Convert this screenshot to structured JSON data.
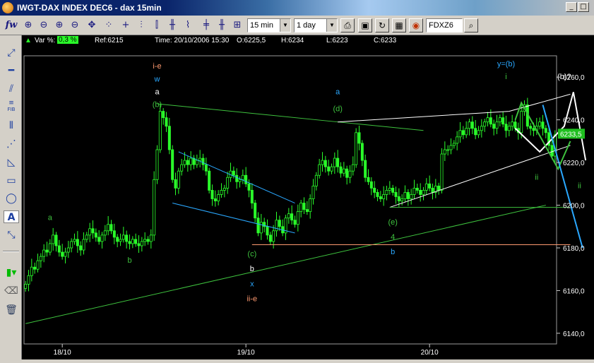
{
  "window": {
    "title": "IWGT-DAX INDEX DEC6 - dax 15min"
  },
  "toolbar": {
    "period": "15 min",
    "range": "1 day",
    "symbol": "FDXZ6",
    "logo_text": "fw"
  },
  "info": {
    "var_label": "Var %:",
    "var_value": "0,3 %",
    "ref": "Ref:6215",
    "time": "Time: 20/10/2006 15:30",
    "open": "O:6225,5",
    "high": "H:6234",
    "low": "L:6223",
    "close": "C:6233"
  },
  "left_toolbar": {
    "fib_label": "FIB",
    "text_tool_label": "A"
  },
  "colors": {
    "candles": "#2aff2a",
    "wave_green": "#3ec23e",
    "wave_blue": "#2aa8ff",
    "wave_white": "#ffffff",
    "wave_orange": "#ff9a70",
    "price_box": "#1fbf1f"
  },
  "chart_data": {
    "type": "candlestick",
    "title": "",
    "ylim": [
      6135,
      6270
    ],
    "yticks": [
      "6260,0",
      "6240,0",
      "6220,0",
      "6200,0",
      "6180,0",
      "6160,0",
      "6140,0"
    ],
    "xticks": [
      "18/10",
      "19/10",
      "20/10"
    ],
    "last_price_label": "6233,5",
    "closes": [
      6163,
      6167,
      6171,
      6170,
      6174,
      6176,
      6179,
      6178,
      6182,
      6186,
      6181,
      6178,
      6176,
      6178,
      6180,
      6183,
      6184,
      6181,
      6179,
      6184,
      6186,
      6189,
      6187,
      6185,
      6183,
      6186,
      6188,
      6191,
      6188,
      6185,
      6183,
      6184,
      6186,
      6183,
      6182,
      6184,
      6182,
      6181,
      6183,
      6184,
      6183,
      6186,
      6212,
      6226,
      6244,
      6241,
      6237,
      6226,
      6212,
      6208,
      6216,
      6219,
      6221,
      6219,
      6222,
      6219,
      6221,
      6222,
      6219,
      6216,
      6207,
      6203,
      6202,
      6205,
      6207,
      6208,
      6213,
      6216,
      6214,
      6211,
      6212,
      6214,
      6210,
      6207,
      6201,
      6194,
      6187,
      6192,
      6190,
      6186,
      6183,
      6188,
      6193,
      6190,
      6187,
      6194,
      6196,
      6193,
      6191,
      6197,
      6201,
      6198,
      6197,
      6203,
      6209,
      6214,
      6219,
      6221,
      6218,
      6216,
      6218,
      6222,
      6218,
      6215,
      6217,
      6213,
      6216,
      6219,
      6234,
      6229,
      6221,
      6213,
      6211,
      6208,
      6206,
      6204,
      6203,
      6205,
      6207,
      6208,
      6206,
      6204,
      6202,
      6203,
      6206,
      6203,
      6205,
      6208,
      6207,
      6205,
      6207,
      6210,
      6208,
      6206,
      6209,
      6207,
      6224,
      6226,
      6226,
      6228,
      6229,
      6232,
      6235,
      6233,
      6236,
      6239,
      6236,
      6233,
      6235,
      6237,
      6239,
      6241,
      6238,
      6236,
      6239,
      6241,
      6238,
      6235,
      6237,
      6239,
      6236,
      6234,
      6244,
      6247,
      6237,
      6236,
      6235,
      6237,
      6239,
      6236,
      6234,
      6228,
      6223,
      6233
    ],
    "trend_lines": [
      {
        "points": [
          [
            0,
            6144.5
          ],
          [
            170,
            6200
          ]
        ],
        "color": "wave_green"
      },
      {
        "points": [
          [
            43,
            6247.5
          ],
          [
            102,
            6239
          ],
          [
            130,
            6235
          ]
        ],
        "color": "wave_green"
      },
      {
        "points": [
          [
            102,
            6239
          ],
          [
            158,
            6244
          ],
          [
            178,
            6252
          ]
        ],
        "color": "wave_white"
      },
      {
        "points": [
          [
            119,
            6199
          ],
          [
            178,
            6228
          ]
        ],
        "color": "wave_white"
      },
      {
        "points": [
          [
            50,
            6225
          ],
          [
            88,
            6201
          ]
        ],
        "color": "wave_blue"
      },
      {
        "points": [
          [
            48,
            6201
          ],
          [
            88,
            6187
          ]
        ],
        "color": "wave_blue"
      },
      {
        "points": [
          [
            119,
            6199
          ],
          [
            178,
            6199
          ]
        ],
        "color": "wave_green"
      },
      {
        "points": [
          [
            74,
            6181.5
          ],
          [
            178,
            6181.5
          ]
        ],
        "color": "wave_orange"
      }
    ],
    "projections": [
      {
        "points": [
          [
            160,
            6236
          ],
          [
            168,
            6225
          ],
          [
            176,
            6237
          ],
          [
            179,
            6253
          ],
          [
            183,
            6221
          ]
        ],
        "color": "wave_white"
      },
      {
        "points": [
          [
            160,
            6240
          ],
          [
            162,
            6248
          ],
          [
            169,
            6230
          ],
          [
            174,
            6217
          ],
          [
            178,
            6230
          ]
        ],
        "color": "wave_green"
      },
      {
        "points": [
          [
            169,
            6247
          ],
          [
            182,
            6180
          ]
        ],
        "color": "wave_blue"
      }
    ],
    "annotations": [
      {
        "text": "i-e",
        "x": 43,
        "y": 6264,
        "color": "wave_orange"
      },
      {
        "text": "w",
        "x": 43,
        "y": 6258,
        "color": "wave_blue"
      },
      {
        "text": "a",
        "x": 43,
        "y": 6252,
        "color": "wave_white"
      },
      {
        "text": "(b)",
        "x": 43,
        "y": 6246,
        "color": "wave_green"
      },
      {
        "text": "a",
        "x": 8,
        "y": 6193,
        "color": "wave_green"
      },
      {
        "text": "b",
        "x": 34,
        "y": 6173,
        "color": "wave_green"
      },
      {
        "text": "(c)",
        "x": 74,
        "y": 6176,
        "color": "wave_green"
      },
      {
        "text": "b",
        "x": 74,
        "y": 6169,
        "color": "wave_white"
      },
      {
        "text": "x",
        "x": 74,
        "y": 6162,
        "color": "wave_blue"
      },
      {
        "text": "ii-e",
        "x": 74,
        "y": 6155,
        "color": "wave_orange"
      },
      {
        "text": "a",
        "x": 102,
        "y": 6252,
        "color": "wave_blue"
      },
      {
        "text": "(d)",
        "x": 102,
        "y": 6244,
        "color": "wave_green"
      },
      {
        "text": "(e)",
        "x": 120,
        "y": 6191,
        "color": "wave_green"
      },
      {
        "text": "4",
        "x": 120,
        "y": 6184,
        "color": "wave_green"
      },
      {
        "text": "b",
        "x": 120,
        "y": 6177,
        "color": "wave_blue"
      },
      {
        "text": "y=(b)",
        "x": 157,
        "y": 6265,
        "color": "wave_blue"
      },
      {
        "text": "i",
        "x": 157,
        "y": 6259,
        "color": "wave_green"
      },
      {
        "text": "(b)?",
        "x": 176,
        "y": 6259,
        "color": "wave_white"
      },
      {
        "text": "ii",
        "x": 167,
        "y": 6212,
        "color": "wave_green"
      },
      {
        "text": "ii",
        "x": 181,
        "y": 6208,
        "color": "wave_green"
      }
    ]
  }
}
